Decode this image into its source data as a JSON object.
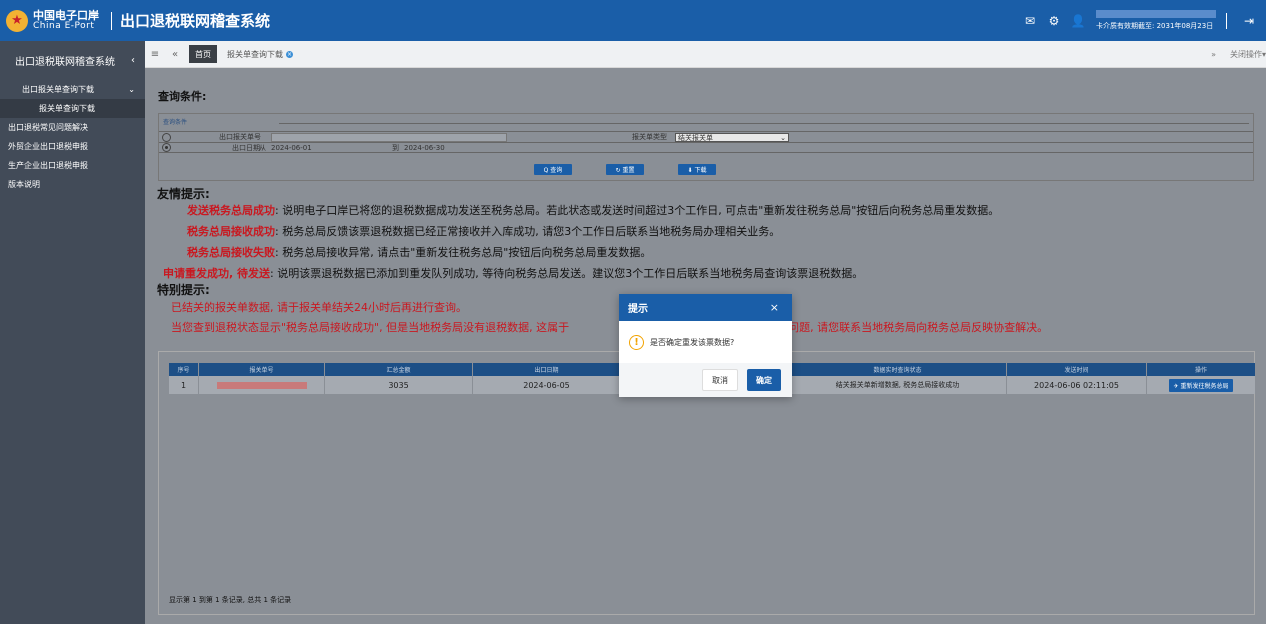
{
  "header": {
    "brand_cn": "中国电子口岸",
    "brand_en": "China E-Port",
    "system_title": "出口退税联网稽查系统",
    "card_valid": "卡介质有效期截至: 2031年08月23日"
  },
  "sidebar": {
    "title": "出口退税联网稽查系统",
    "group": "出口报关单查询下载",
    "active_item": "报关单查询下载",
    "items": [
      "出口退税常见问题解决",
      "外贸企业出口退税申报",
      "生产企业出口退税申报",
      "版本说明"
    ]
  },
  "tabs": {
    "home": "首页",
    "current": "报关单查询下载",
    "close_ops": "关闭操作"
  },
  "query": {
    "title": "查询条件:",
    "legend": "查询条件",
    "decl_no_label": "出口报关单号",
    "decl_type_label": "报关单类型",
    "decl_type_value": "结关报关单",
    "export_date_label": "出口日期",
    "from_label": "从",
    "from_value": "2024-06-01",
    "to_label": "到",
    "to_value": "2024-06-30",
    "btn_query": "Q 查询",
    "btn_reset": "↻ 重置",
    "btn_download": "⬇ 下载"
  },
  "tips": {
    "friendly_title": "友情提示:",
    "lines": [
      {
        "key": "发送税务总局成功",
        "text": ": 说明电子口岸已将您的退税数据成功发送至税务总局。若此状态或发送时间超过3个工作日, 可点击\"重新发往税务总局\"按钮后向税务总局重发数据。"
      },
      {
        "key": "税务总局接收成功",
        "text": ": 税务总局反馈该票退税数据已经正常接收并入库成功, 请您3个工作日后联系当地税务局办理相关业务。"
      },
      {
        "key": "税务总局接收失败",
        "text": ": 税务总局接收异常, 请点击\"重新发往税务总局\"按钮后向税务总局重发数据。"
      },
      {
        "key": "申请重发成功, 待发送",
        "text": ": 说明该票退税数据已添加到重发队列成功, 等待向税务总局发送。建议您3个工作日后联系当地税务局查询该票退税数据。"
      }
    ],
    "special_title": "特别提示:",
    "special_1": "已结关的报关单数据, 请于报关单结关24小时后再进行查询。",
    "special_2_a": "当您查到退税状态显示\"税务总局接收成功\", 但是当地税务局没有退税数据, 这属于",
    "special_2_b": "数据传输问题, 请您联系当地税务局向税务总局反映协查解决。"
  },
  "grid": {
    "headers": [
      "序号",
      "报关单号",
      "汇总金额",
      "出口日期",
      "",
      "数据实时查询状态",
      "发送时间",
      "操作"
    ],
    "row": {
      "index": "1",
      "amount": "3035",
      "export_date": "2024-06-05",
      "status": "结关报关单新增数据, 税务总局接收成功",
      "send_time": "2024-06-06 02:11:05",
      "action": "✈ 重新发往税务总局"
    },
    "footer": "显示第 1 到第 1 条记录, 总共 1 条记录"
  },
  "dialog": {
    "title": "提示",
    "message": "是否确定重发该票数据?",
    "cancel": "取消",
    "ok": "确定"
  }
}
